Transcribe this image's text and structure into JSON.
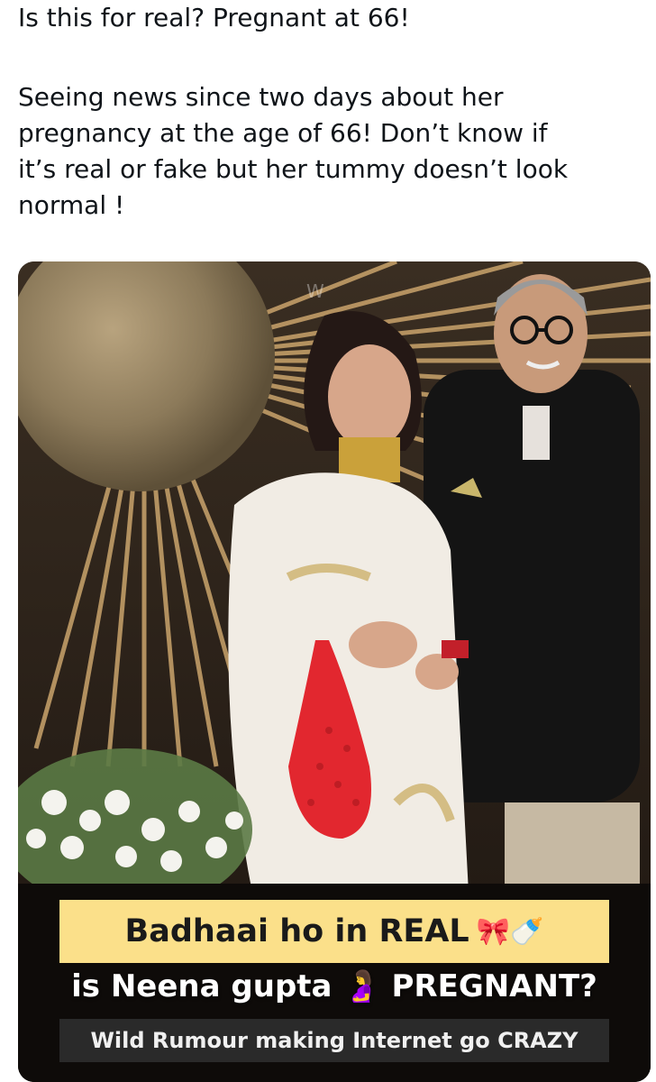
{
  "tweet": {
    "line1": "Is this for real? Pregnant at 66!",
    "para_line1": "Seeing news since two days about her",
    "para_line2": "pregnancy at the age of 66! Don’t know if",
    "para_line3": "it’s real or fake but her tummy doesn’t look",
    "para_line4": "normal !"
  },
  "media": {
    "watermark": "W",
    "caption_line1": "Badhaai ho in REAL",
    "caption_line1_emoji": "🎀🍼",
    "caption_line2": "is Neena gupta 🤰 PREGNANT?",
    "caption_line3": "Wild Rumour making Internet go CRAZY",
    "colors": {
      "highlight_bg": "#fbe08a",
      "subtitle_bg": "#2a2a2a",
      "accent_red": "#e2272f"
    }
  }
}
